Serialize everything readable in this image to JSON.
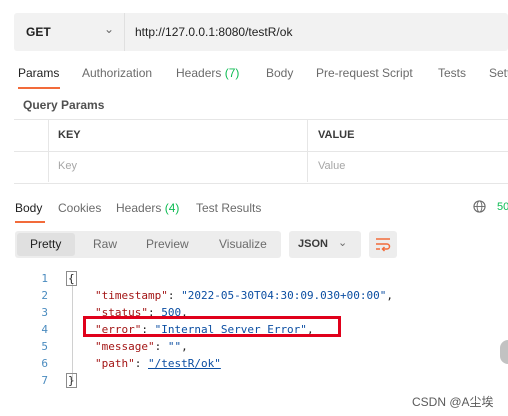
{
  "request": {
    "method": "GET",
    "url": "http://127.0.0.1:8080/testR/ok"
  },
  "request_tabs": [
    {
      "label": "Params",
      "count": ""
    },
    {
      "label": "Authorization",
      "count": ""
    },
    {
      "label": "Headers",
      "count": "(7)"
    },
    {
      "label": "Body",
      "count": ""
    },
    {
      "label": "Pre-request Script",
      "count": ""
    },
    {
      "label": "Tests",
      "count": ""
    },
    {
      "label": "Setti",
      "count": ""
    }
  ],
  "query_params": {
    "title": "Query Params",
    "columns": [
      "KEY",
      "VALUE"
    ],
    "placeholders": {
      "key": "Key",
      "value": "Value"
    }
  },
  "response_tabs": [
    {
      "label": "Body",
      "count": ""
    },
    {
      "label": "Cookies",
      "count": ""
    },
    {
      "label": "Headers",
      "count": "(4)"
    },
    {
      "label": "Test Results",
      "count": ""
    }
  ],
  "status_truncated": "50",
  "view_modes": [
    "Pretty",
    "Raw",
    "Preview",
    "Visualize"
  ],
  "format": "JSON",
  "code": {
    "line_numbers": [
      "1",
      "2",
      "3",
      "4",
      "5",
      "6",
      "7"
    ],
    "open_brace": "{",
    "close_brace": "}",
    "lines": [
      {
        "key": "\"timestamp\"",
        "value": "\"2022-05-30T04:30:09.030+00:00\""
      },
      {
        "key": "\"status\"",
        "value": "500"
      },
      {
        "key": "\"error\"",
        "value": "\"Internal Server Error\""
      },
      {
        "key": "\"message\"",
        "value": "\"\""
      },
      {
        "key": "\"path\"",
        "value": "\"/testR/ok\""
      }
    ]
  },
  "watermark": "CSDN @A尘埃",
  "colors": {
    "accent": "#f26b3a",
    "count": "#0cbb52",
    "highlight": "#e0001b"
  }
}
